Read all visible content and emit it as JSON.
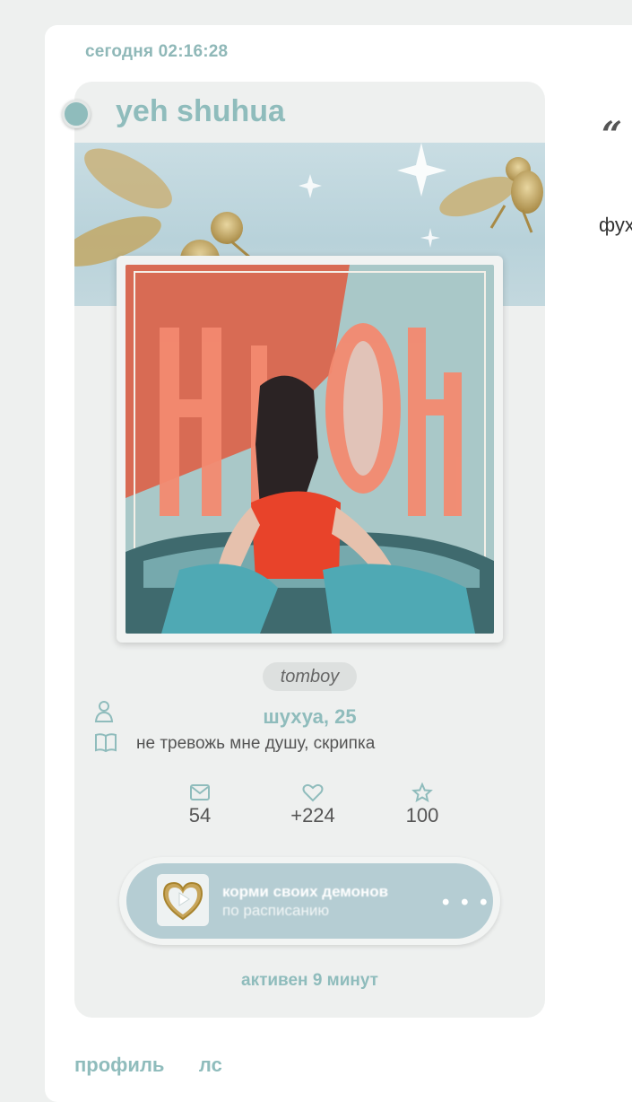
{
  "post": {
    "date": "сегодня 02:16:28",
    "username": "yeh shuhua",
    "tag": "tomboy",
    "display_name": "шухуа, 25",
    "bio": "не тревожь мне душу, скрипка",
    "stats": [
      {
        "icon": "mail-icon",
        "value": "54"
      },
      {
        "icon": "heart-icon",
        "value": "+224"
      },
      {
        "icon": "star-icon",
        "value": "100"
      }
    ],
    "player": {
      "title": "корми своих демонов",
      "subtitle": "по расписанию",
      "more": "• • •"
    },
    "last_active": "активен 9 минут"
  },
  "side": {
    "quote": "“",
    "text": "фух"
  },
  "tabs": [
    "профиль",
    "лс"
  ],
  "colors": {
    "accent": "#8fbcbc",
    "background": "#eef0ef",
    "player": "#b5cdd3"
  }
}
